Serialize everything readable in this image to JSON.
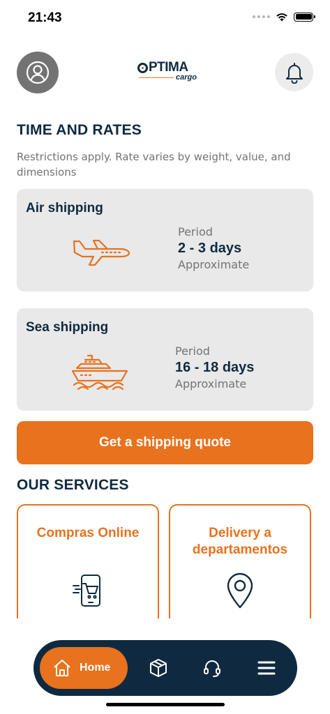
{
  "status_bar": {
    "time": "21:43"
  },
  "header": {
    "logo_main": "PTIMA",
    "logo_sub": "cargo"
  },
  "time_rates": {
    "title": "TIME AND RATES",
    "subtitle": "Restrictions apply. Rate varies by weight, value, and dimensions"
  },
  "air": {
    "title": "Air shipping",
    "period_label": "Period",
    "period_value": "2 - 3 days",
    "note": "Approximate"
  },
  "sea": {
    "title": "Sea shipping",
    "period_label": "Period",
    "period_value": "16 - 18 days",
    "note": "Approximate"
  },
  "quote_button": "Get a shipping quote",
  "services": {
    "title": "OUR SERVICES",
    "items": [
      {
        "label": "Compras Online",
        "icon": "mobile-cart-icon"
      },
      {
        "label": "Delivery a departamentos",
        "icon": "map-pin-icon"
      }
    ]
  },
  "nav": {
    "home_label": "Home",
    "items": [
      "home-icon",
      "package-icon",
      "headset-icon",
      "menu-icon"
    ]
  },
  "colors": {
    "brand_orange": "#e8721e",
    "brand_navy": "#0f2a40",
    "card_gray": "#e9e9e9"
  }
}
